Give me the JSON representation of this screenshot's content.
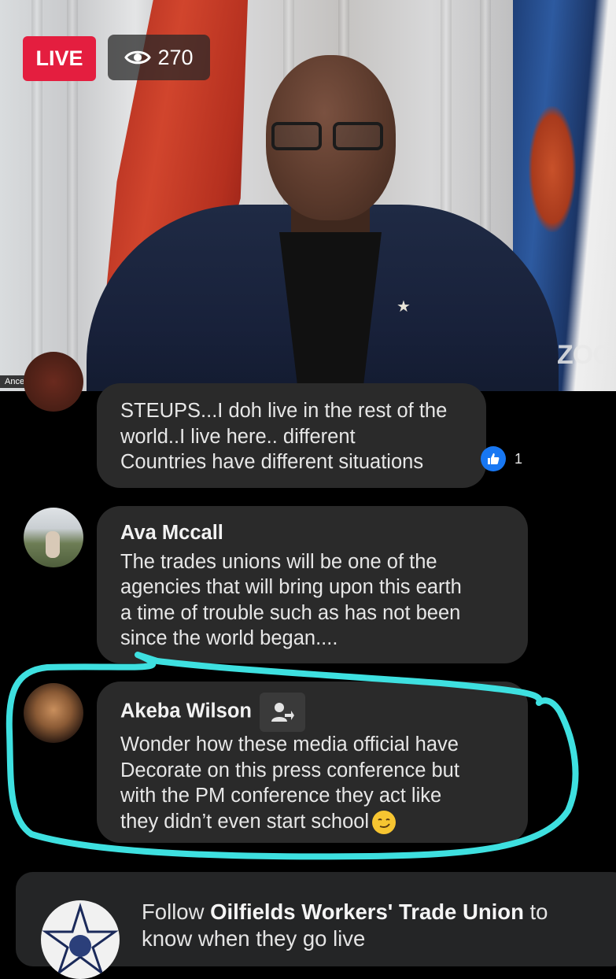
{
  "live_badge": {
    "label": "LIVE",
    "color": "#e41e3f"
  },
  "viewers": {
    "count": "270",
    "icon": "eye-icon"
  },
  "video": {
    "speaker_name_tag": "Ancel Roget",
    "watermark": "ZOO"
  },
  "comments": [
    {
      "author": "",
      "lines": [
        "STEUPS...I doh live in the rest of the",
        "world..I live here.. different",
        "Countries have different situations"
      ],
      "reaction": {
        "icon": "like-icon",
        "count": "1"
      }
    },
    {
      "author": "Ava Mccall",
      "lines": [
        "The trades unions will be one of the",
        "agencies that will bring upon this earth",
        "a time of trouble such as has not been",
        "since the world began...."
      ]
    },
    {
      "author": "Akeba Wilson",
      "author_badge_icon": "new-member-icon",
      "lines": [
        "Wonder how these media official have",
        "Decorate on this press conference but",
        "with the PM conference they act like",
        "they didn’t even start school"
      ],
      "emoji": "smirk-emoji"
    }
  ],
  "follow": {
    "prefix": "Follow ",
    "page_name": "Oilfields Workers' Trade Union",
    "suffix": " to",
    "line2": "know when they go live"
  },
  "colors": {
    "highlight": "#3ee0e0",
    "bubble": "#2a2a2a",
    "like": "#1877f2"
  }
}
